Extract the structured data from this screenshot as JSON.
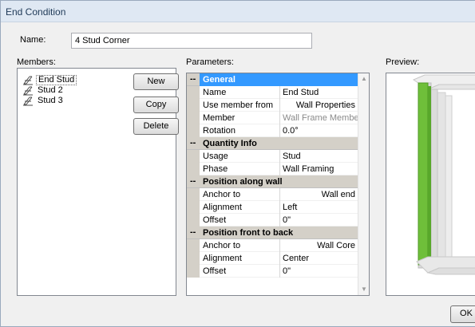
{
  "window": {
    "title": "End Condition"
  },
  "name_field": {
    "label": "Name:",
    "value": "4 Stud Corner"
  },
  "members": {
    "label": "Members:",
    "items": [
      {
        "label": "End Stud",
        "icon": "stud-icon",
        "selected": true
      },
      {
        "label": "Stud 2",
        "icon": "stud-icon",
        "selected": false
      },
      {
        "label": "Stud 3",
        "icon": "stud-icon",
        "selected": false
      }
    ]
  },
  "buttons": {
    "new": "New",
    "copy": "Copy",
    "delete": "Delete",
    "ok": "OK"
  },
  "parameters": {
    "label": "Parameters:",
    "toggle_symbol": "--",
    "categories": [
      {
        "title": "General",
        "selected": true,
        "rows": [
          {
            "name": "Name",
            "value": "End Stud",
            "align": "left",
            "disabled": false
          },
          {
            "name": "Use member from",
            "value": "Wall Properties",
            "align": "right",
            "disabled": false
          },
          {
            "name": "Member",
            "value": "Wall Frame Member",
            "align": "right",
            "disabled": true
          },
          {
            "name": "Rotation",
            "value": "0.0°",
            "align": "left",
            "disabled": false
          }
        ]
      },
      {
        "title": "Quantity Info",
        "selected": false,
        "rows": [
          {
            "name": "Usage",
            "value": "Stud",
            "align": "left",
            "disabled": false
          },
          {
            "name": "Phase",
            "value": "Wall Framing",
            "align": "left",
            "disabled": false
          }
        ]
      },
      {
        "title": "Position along wall",
        "selected": false,
        "rows": [
          {
            "name": "Anchor to",
            "value": "Wall end",
            "align": "right",
            "disabled": false
          },
          {
            "name": "Alignment",
            "value": "Left",
            "align": "left",
            "disabled": false
          },
          {
            "name": "Offset",
            "value": "0\"",
            "align": "left",
            "disabled": false
          }
        ]
      },
      {
        "title": "Position front to back",
        "selected": false,
        "rows": [
          {
            "name": "Anchor to",
            "value": "Wall Core",
            "align": "right",
            "disabled": false
          },
          {
            "name": "Alignment",
            "value": "Center",
            "align": "left",
            "disabled": false
          },
          {
            "name": "Offset",
            "value": "0\"",
            "align": "left",
            "disabled": false
          }
        ]
      }
    ]
  },
  "preview": {
    "label": "Preview:"
  },
  "colors": {
    "accent_selection": "#3399ff",
    "stud_highlight": "#6fbf3a",
    "stud_other": "#e2e2e2"
  }
}
